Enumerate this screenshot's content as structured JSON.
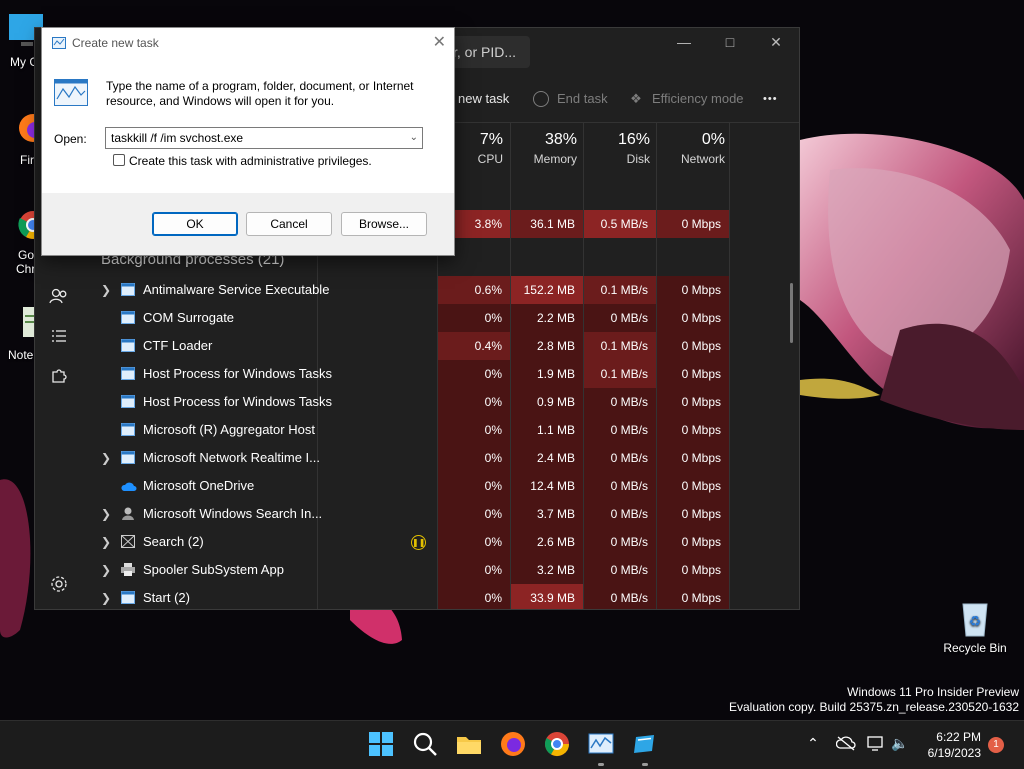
{
  "desktop": {
    "icons": [
      {
        "label": "My Co"
      },
      {
        "label": "Fir"
      },
      {
        "label": "Go",
        "label2": "Chr"
      },
      {
        "label": "Note"
      }
    ],
    "recycle_bin": "Recycle Bin",
    "watermark_line1": "Windows 11 Pro Insider Preview",
    "watermark_line2": "Evaluation copy. Build 25375.zn_release.230520-1632"
  },
  "task_manager": {
    "search_placeholder": "r, or PID...",
    "toolbar": {
      "new_task": "new task",
      "end_task": "End task",
      "efficiency_mode": "Efficiency mode",
      "more": "•••"
    },
    "columns": [
      {
        "pct": "7%",
        "name": "CPU"
      },
      {
        "pct": "38%",
        "name": "Memory"
      },
      {
        "pct": "16%",
        "name": "Disk"
      },
      {
        "pct": "0%",
        "name": "Network"
      }
    ],
    "app_row": {
      "cpu": "3.8%",
      "memory": "36.1 MB",
      "disk": "0.5 MB/s",
      "network": "0 Mbps"
    },
    "group_title": "Background processes (21)",
    "processes": [
      {
        "name": "Antimalware Service Executable",
        "cpu": "0.6%",
        "memory": "152.2 MB",
        "disk": "0.1 MB/s",
        "network": "0 Mbps",
        "expandable": true,
        "icon": "window-icon"
      },
      {
        "name": "COM Surrogate",
        "cpu": "0%",
        "memory": "2.2 MB",
        "disk": "0 MB/s",
        "network": "0 Mbps",
        "expandable": false,
        "icon": "window-icon"
      },
      {
        "name": "CTF Loader",
        "cpu": "0.4%",
        "memory": "2.8 MB",
        "disk": "0.1 MB/s",
        "network": "0 Mbps",
        "expandable": false,
        "icon": "window-icon"
      },
      {
        "name": "Host Process for Windows Tasks",
        "cpu": "0%",
        "memory": "1.9 MB",
        "disk": "0.1 MB/s",
        "network": "0 Mbps",
        "expandable": false,
        "icon": "window-icon"
      },
      {
        "name": "Host Process for Windows Tasks",
        "cpu": "0%",
        "memory": "0.9 MB",
        "disk": "0 MB/s",
        "network": "0 Mbps",
        "expandable": false,
        "icon": "window-icon"
      },
      {
        "name": "Microsoft (R) Aggregator Host",
        "cpu": "0%",
        "memory": "1.1 MB",
        "disk": "0 MB/s",
        "network": "0 Mbps",
        "expandable": false,
        "icon": "window-icon"
      },
      {
        "name": "Microsoft Network Realtime I...",
        "cpu": "0%",
        "memory": "2.4 MB",
        "disk": "0 MB/s",
        "network": "0 Mbps",
        "expandable": true,
        "icon": "window-icon"
      },
      {
        "name": "Microsoft OneDrive",
        "cpu": "0%",
        "memory": "12.4 MB",
        "disk": "0 MB/s",
        "network": "0 Mbps",
        "expandable": false,
        "icon": "cloud-icon"
      },
      {
        "name": "Microsoft Windows Search In...",
        "cpu": "0%",
        "memory": "3.7 MB",
        "disk": "0 MB/s",
        "network": "0 Mbps",
        "expandable": true,
        "icon": "search-user-icon"
      },
      {
        "name": "Search (2)",
        "cpu": "0%",
        "memory": "2.6 MB",
        "disk": "0 MB/s",
        "network": "0 Mbps",
        "expandable": true,
        "icon": "empty-box-icon",
        "suspended": true
      },
      {
        "name": "Spooler SubSystem App",
        "cpu": "0%",
        "memory": "3.2 MB",
        "disk": "0 MB/s",
        "network": "0 Mbps",
        "expandable": true,
        "icon": "printer-icon"
      },
      {
        "name": "Start (2)",
        "cpu": "0%",
        "memory": "33.9 MB",
        "disk": "0 MB/s",
        "network": "0 Mbps",
        "expandable": true,
        "icon": "window-icon"
      }
    ],
    "colors": {
      "heat_low": "#4a1414",
      "heat_mid": "#6b1c1c",
      "heat_high": "#8c2424"
    }
  },
  "run_dialog": {
    "title": "Create new task",
    "description": "Type the name of a program, folder, document, or Internet resource, and Windows will open it for you.",
    "open_label": "Open:",
    "command": "taskkill /f /im svchost.exe",
    "admin_label": "Create this task with administrative privileges.",
    "ok": "OK",
    "cancel": "Cancel",
    "browse": "Browse..."
  },
  "taskbar": {
    "time": "6:22 PM",
    "date": "6/19/2023",
    "notifications": "1"
  }
}
